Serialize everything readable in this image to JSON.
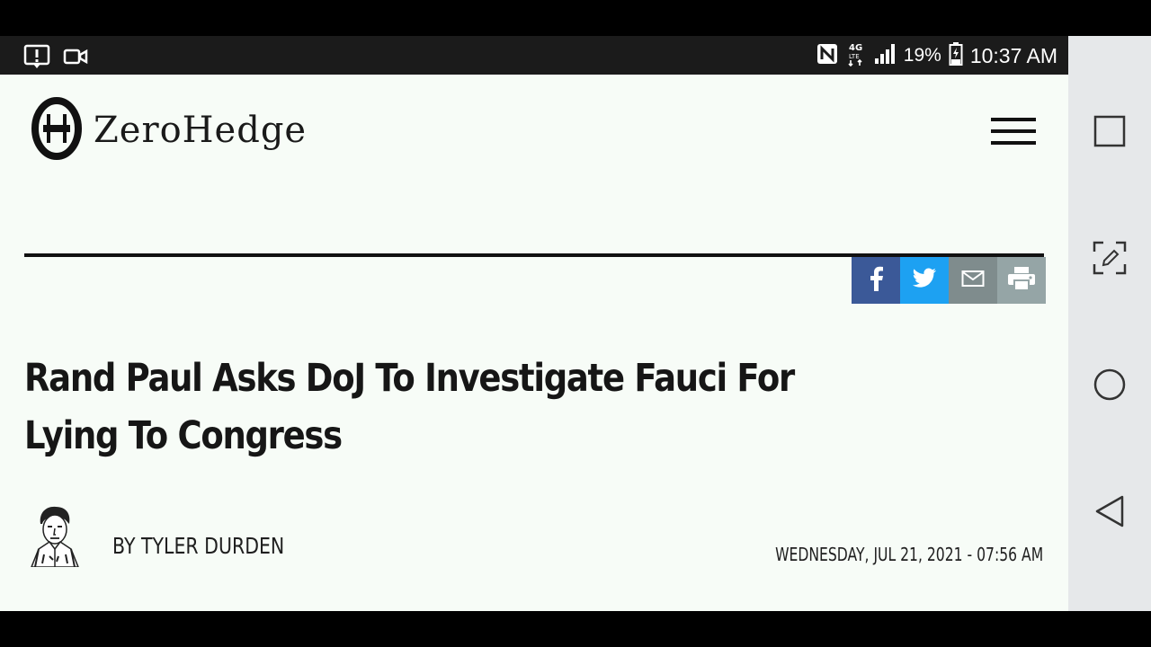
{
  "status_bar": {
    "icons_left": [
      "alert-icon",
      "video-camera-icon"
    ],
    "icons_right": [
      "nfc-icon",
      "4g-lte-icon",
      "signal-icon",
      "battery-icon"
    ],
    "battery_percent": "19%",
    "time": "10:37 AM"
  },
  "site": {
    "logo_mark": "Θ",
    "name": "ZeroHedge"
  },
  "share": {
    "buttons": [
      "facebook-icon",
      "twitter-icon",
      "mail-icon",
      "print-icon"
    ],
    "colors": {
      "facebook": "#3b5998",
      "twitter": "#1da1f2",
      "mail": "#7f8c8d",
      "print": "#95a5a6"
    }
  },
  "article": {
    "headline": "Rand Paul Asks DoJ To Investigate Fauci For Lying To Congress",
    "byline": "BY TYLER DURDEN",
    "date": "WEDNESDAY, JUL 21, 2021 - 07:56 AM"
  },
  "nav": {
    "buttons": [
      "square-icon",
      "edit-screenshot-icon",
      "home-circle-icon",
      "back-triangle-icon"
    ]
  }
}
